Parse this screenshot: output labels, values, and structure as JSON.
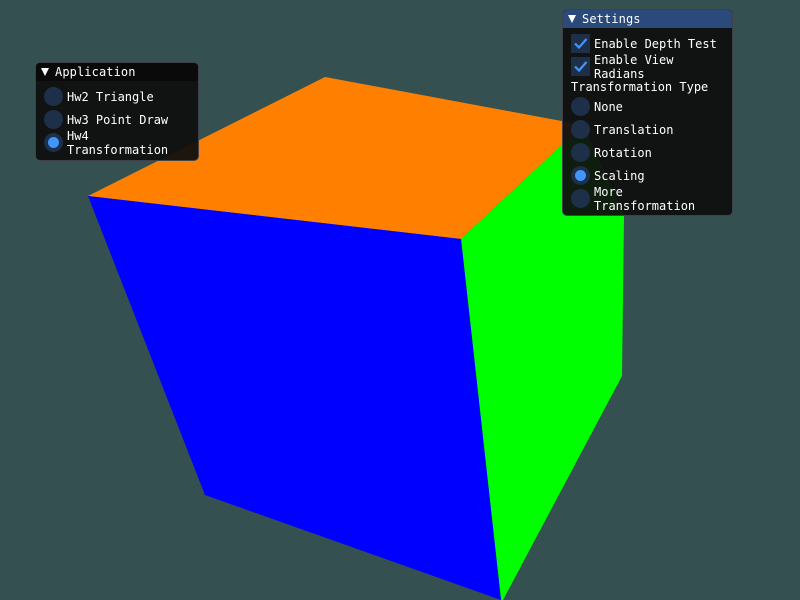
{
  "scene": {
    "background_color": "#345050",
    "cube_faces": {
      "top": "#ff8000",
      "front": "#0000ff",
      "right": "#00ff00"
    }
  },
  "application_window": {
    "title": "Application",
    "selected_index": 2,
    "options": [
      {
        "label": "Hw2 Triangle",
        "selected": false
      },
      {
        "label": "Hw3 Point Draw",
        "selected": false
      },
      {
        "label": "Hw4 Transformation",
        "selected": true
      }
    ]
  },
  "settings_window": {
    "title": "Settings",
    "checkboxes": [
      {
        "label": "Enable Depth Test",
        "checked": true
      },
      {
        "label": "Enable View Radians",
        "checked": true
      }
    ],
    "transformation_type_label": "Transformation Type",
    "transformation_options": [
      {
        "label": "None",
        "selected": false
      },
      {
        "label": "Translation",
        "selected": false
      },
      {
        "label": "Rotation",
        "selected": false
      },
      {
        "label": "Scaling",
        "selected": true
      },
      {
        "label": "More Transformation",
        "selected": false
      }
    ]
  },
  "colors": {
    "accent": "#4296fa",
    "frame_bg": "#1e2f49",
    "title_active": "#294a7a",
    "window_bg": "#0f0f0f"
  }
}
